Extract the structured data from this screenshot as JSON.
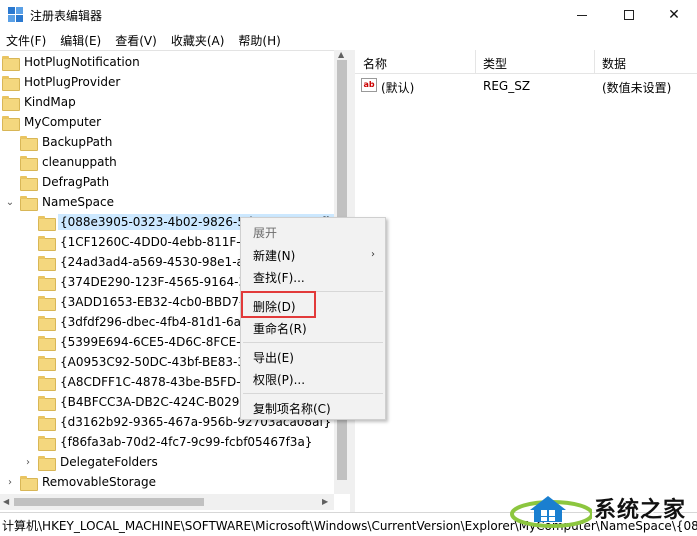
{
  "window": {
    "title": "注册表编辑器"
  },
  "menubar": {
    "items": [
      "文件(F)",
      "编辑(E)",
      "查看(V)",
      "收藏夹(A)",
      "帮助(H)"
    ]
  },
  "tree": {
    "items": [
      {
        "label": "HotPlugNotification",
        "level": 0,
        "expander": ""
      },
      {
        "label": "HotPlugProvider",
        "level": 0,
        "expander": ""
      },
      {
        "label": "KindMap",
        "level": 0,
        "expander": ""
      },
      {
        "label": "MyComputer",
        "level": 0,
        "expander": ""
      },
      {
        "label": "BackupPath",
        "level": 1,
        "expander": ""
      },
      {
        "label": "cleanuppath",
        "level": 1,
        "expander": ""
      },
      {
        "label": "DefragPath",
        "level": 1,
        "expander": ""
      },
      {
        "label": "NameSpace",
        "level": 1,
        "expander": "collapse"
      },
      {
        "label": "{088e3905-0323-4b02-9826-5d99428e115f}",
        "level": 2,
        "expander": "",
        "selected": true
      },
      {
        "label": "{1CF1260C-4DD0-4ebb-811F-33C572699FDE}",
        "level": 2,
        "expander": ""
      },
      {
        "label": "{24ad3ad4-a569-4530-98e1-ab02f9417aa8}",
        "level": 2,
        "expander": ""
      },
      {
        "label": "{374DE290-123F-4565-9164-39C4925E467B}",
        "level": 2,
        "expander": ""
      },
      {
        "label": "{3ADD1653-EB32-4cb0-BBD7-DFA0ABB5ACCA}",
        "level": 2,
        "expander": ""
      },
      {
        "label": "{3dfdf296-dbec-4fb4-81d1-6a3438bcf4de}",
        "level": 2,
        "expander": ""
      },
      {
        "label": "{5399E694-6CE5-4D6C-8FCE-1D8870FDCBA0}",
        "level": 2,
        "expander": ""
      },
      {
        "label": "{A0953C92-50DC-43bf-BE83-3742FED03C9C}",
        "level": 2,
        "expander": ""
      },
      {
        "label": "{A8CDFF1C-4878-43be-B5FD-F8091C1C60D0}",
        "level": 2,
        "expander": ""
      },
      {
        "label": "{B4BFCC3A-DB2C-424C-B029-7FE99A87C641}",
        "level": 2,
        "expander": ""
      },
      {
        "label": "{d3162b92-9365-467a-956b-92703aca08af}",
        "level": 2,
        "expander": ""
      },
      {
        "label": "{f86fa3ab-70d2-4fc7-9c99-fcbf05467f3a}",
        "level": 2,
        "expander": ""
      },
      {
        "label": "DelegateFolders",
        "level": 2,
        "expander": "expand"
      },
      {
        "label": "RemovableStorage",
        "level": 1,
        "expander": "expand"
      }
    ]
  },
  "list": {
    "headers": {
      "name": "名称",
      "type": "类型",
      "data": "数据"
    },
    "rows": [
      {
        "name": "(默认)",
        "type": "REG_SZ",
        "data": "(数值未设置)"
      }
    ]
  },
  "context_menu": {
    "expand": "展开",
    "new": "新建(N)",
    "find": "查找(F)...",
    "delete": "删除(D)",
    "rename": "重命名(R)",
    "export": "导出(E)",
    "permissions": "权限(P)...",
    "copy_key_name": "复制项名称(C)",
    "highlight_color": "#e23a3a"
  },
  "statusbar": {
    "path": "计算机\\HKEY_LOCAL_MACHINE\\SOFTWARE\\Microsoft\\Windows\\CurrentVersion\\Explorer\\MyComputer\\NameSpace\\{088e3905-0323-4b02-9826-5d99428e115f}"
  },
  "watermark": {
    "text": "系统之家"
  },
  "colors": {
    "selection": "#cce8ff",
    "folder": "#f4d77e",
    "accent": "#2b79d0"
  }
}
